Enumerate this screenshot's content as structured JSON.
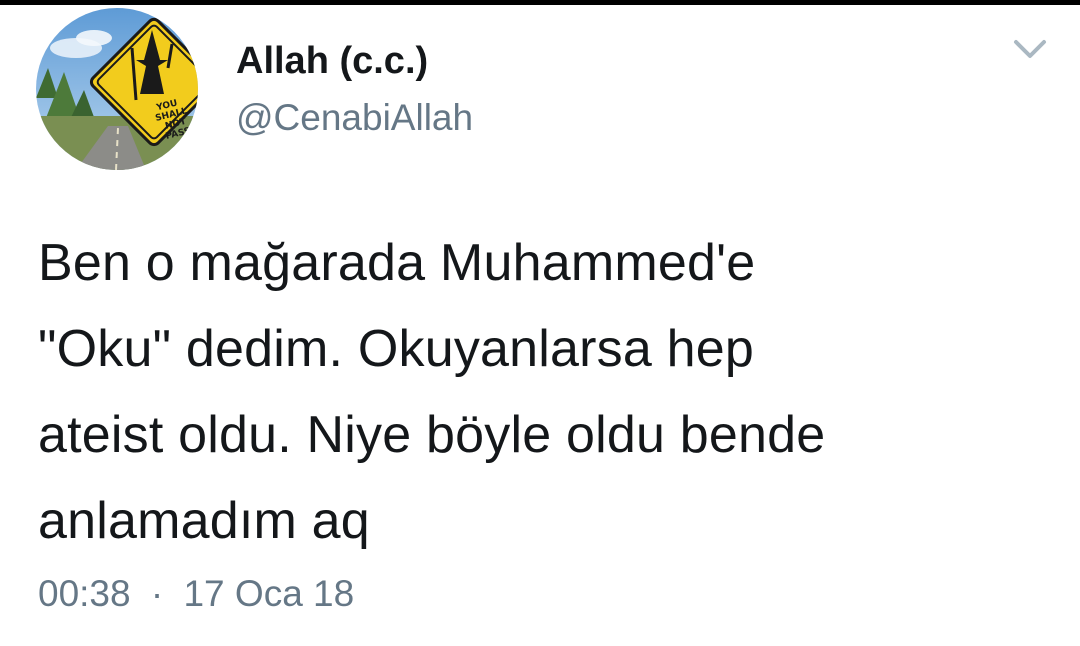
{
  "user": {
    "display_name": "Allah (c.c.)",
    "handle": "@CenabiAllah",
    "avatar": {
      "icon": "you-shall-not-pass-sign-avatar",
      "sign_text": [
        "YOU",
        "SHALL",
        "NOT",
        "PASS!"
      ],
      "sign_color": "#f2cc1d",
      "sky_color": "#7fb3e0"
    }
  },
  "tweet": {
    "text": "Ben o mağarada Muhammed'e\n\"Oku\" dedim. Okuyanlarsa hep\nateist oldu. Niye böyle oldu bende\nanlamadım aq",
    "time": "00:38",
    "separator": "·",
    "date": "17 Oca 18"
  },
  "menu": {
    "icon": "chevron-down-icon"
  },
  "colors": {
    "text": "#14171a",
    "secondary": "#657786",
    "chevron": "#aab8c2"
  }
}
